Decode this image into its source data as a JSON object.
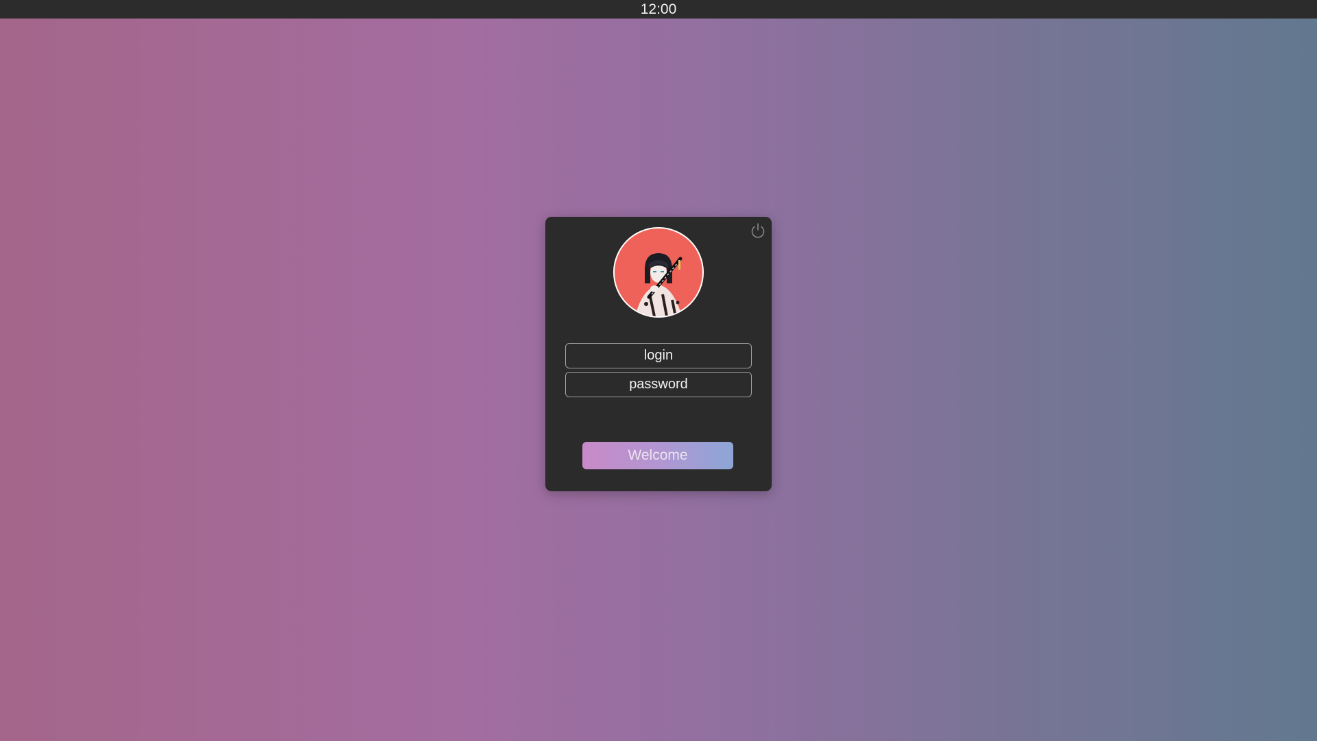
{
  "topbar": {
    "clock": "12:00"
  },
  "login_card": {
    "login_placeholder": "login",
    "password_placeholder": "password",
    "submit_label": "Welcome",
    "power_icon": "power-icon",
    "avatar_icon": "user-avatar"
  },
  "colors": {
    "topbar_bg": "#2d2c2c",
    "card_bg": "#2c2b2b",
    "avatar_bg": "#ef6259",
    "button_gradient_start": "#c88ac7",
    "button_gradient_end": "#8da6d6",
    "wallpaper_left": "#a4668a",
    "wallpaper_right": "#62788f"
  }
}
